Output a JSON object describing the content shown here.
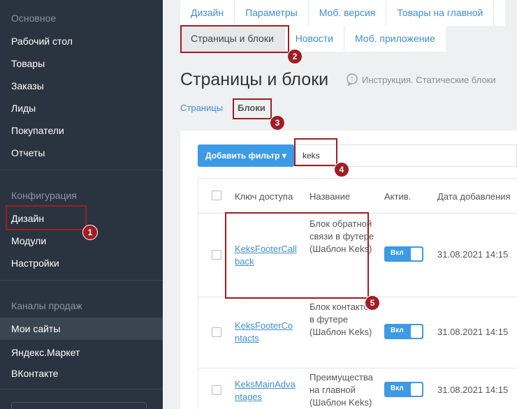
{
  "sidebar": {
    "sections": [
      {
        "label": "Основное"
      },
      {
        "label": "Конфигурация"
      },
      {
        "label": "Каналы продаж"
      }
    ],
    "items": [
      {
        "label": "Рабочий стол"
      },
      {
        "label": "Товары"
      },
      {
        "label": "Заказы"
      },
      {
        "label": "Лиды"
      },
      {
        "label": "Покупатели"
      },
      {
        "label": "Отчеты"
      },
      {
        "label": "Дизайн"
      },
      {
        "label": "Модули"
      },
      {
        "label": "Настройки"
      },
      {
        "label": "Мои сайты"
      },
      {
        "label": "Яндекс.Маркет"
      },
      {
        "label": "ВКонтакте"
      }
    ]
  },
  "tabs": {
    "row1": [
      "Дизайн",
      "Параметры",
      "Моб. версия",
      "Товары на главной"
    ],
    "row2": [
      "Страницы и блоки",
      "Новости",
      "Моб. приложение"
    ]
  },
  "page": {
    "title": "Страницы и блоки",
    "help_text": "Инструкция. Статические блоки"
  },
  "subnav": {
    "pages": "Страницы",
    "blocks": "Блоки"
  },
  "filter": {
    "button_label": "Добавить фильтр ▾",
    "search_value": "keks"
  },
  "table": {
    "headers": [
      "Ключ доступа",
      "Название",
      "Актив.",
      "Дата добавления"
    ],
    "rows": [
      {
        "key": "KeksFooterCallback",
        "name": "Блок обратной связи в футере (Шаблон Keks)",
        "active": "Вкл",
        "date": "31.08.2021 14:15"
      },
      {
        "key": "KeksFooterContacts",
        "name": "Блок контактов в футере (Шаблон Keks)",
        "active": "Вкл",
        "date": "31.08.2021 14:15"
      },
      {
        "key": "KeksMainAdvantages",
        "name": "Преимущества на главной (Шаблон Keks)",
        "active": "Вкл",
        "date": "31.08.2021 14:15"
      }
    ]
  },
  "annotations": [
    "1",
    "2",
    "3",
    "4",
    "5"
  ],
  "colors": {
    "sidebar_bg": "#2a3440",
    "accent": "#3d9ae4",
    "link": "#3d8ed1",
    "annotation": "#a11d24"
  }
}
